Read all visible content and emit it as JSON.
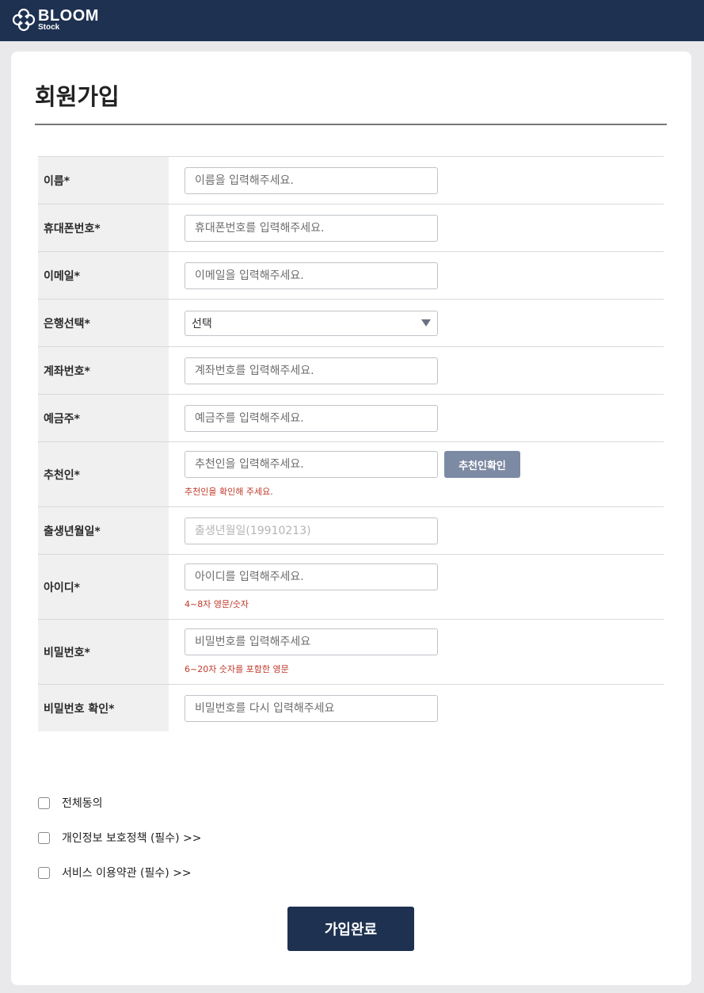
{
  "header": {
    "logo_main": "BLOOM",
    "logo_sub": "Stock",
    "bg_color": "#1e3151"
  },
  "page": {
    "title": "회원가입"
  },
  "form": {
    "name": {
      "label": "이름*",
      "placeholder": "이름을 입력해주세요."
    },
    "phone": {
      "label": "휴대폰번호*",
      "placeholder": "휴대폰번호를 입력해주세요."
    },
    "email": {
      "label": "이메일*",
      "placeholder": "이메일을 입력해주세요."
    },
    "bank": {
      "label": "은행선택*",
      "selected": "선택"
    },
    "account": {
      "label": "계좌번호*",
      "placeholder": "계좌번호를 입력해주세요."
    },
    "holder": {
      "label": "예금주*",
      "placeholder": "예금주를 입력해주세요."
    },
    "referrer": {
      "label": "추천인*",
      "placeholder": "추천인을 입력해주세요.",
      "button": "추천인확인",
      "hint": "추천인을 확인해 주세요."
    },
    "birth": {
      "label": "출생년월일*",
      "placeholder": "출생년월일(19910213)"
    },
    "userid": {
      "label": "아이디*",
      "placeholder": "아이디를 입력해주세요.",
      "hint": "4~8자 영문/숫자"
    },
    "password": {
      "label": "비밀번호*",
      "placeholder": "비밀번호를 입력해주세요",
      "hint": "6~20자 숫자를 포함한 영문"
    },
    "password_confirm": {
      "label": "비밀번호 확인*",
      "placeholder": "비밀번호를 다시 입력해주세요"
    }
  },
  "agreements": {
    "all": "전체동의",
    "privacy": "개인정보 보호정책 (필수) >>",
    "terms": "서비스 이용약관 (필수) >>"
  },
  "submit_label": "가입완료",
  "colors": {
    "primary": "#1e3151",
    "secondary_button": "#7d8aa3",
    "hint": "#c0392b"
  }
}
